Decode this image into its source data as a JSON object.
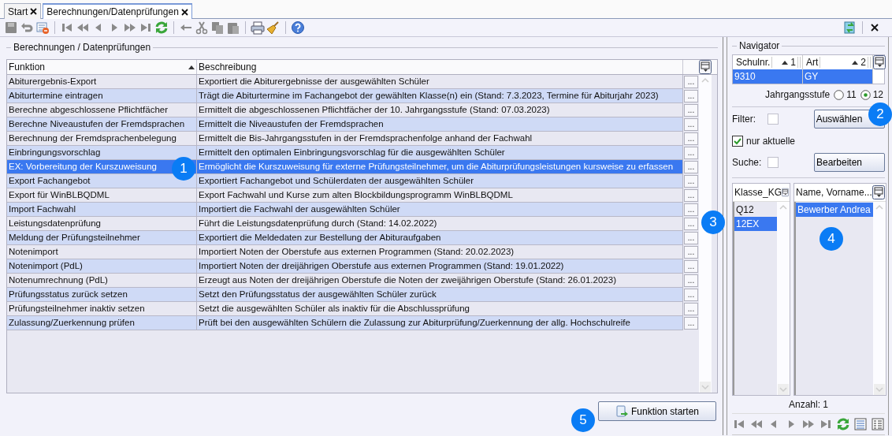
{
  "tabs": [
    {
      "label": "Start",
      "selected": false
    },
    {
      "label": "Berechnungen/Datenprüfungen",
      "selected": true
    }
  ],
  "group_title": "Berechnungen / Datenprüfungen",
  "table": {
    "columns": [
      "Funktion",
      "Beschreibung"
    ],
    "rows": [
      {
        "funktion": "Abiturergebnis-Export",
        "beschreibung": "Exportiert die Abiturergebnisse der ausgewählten Schüler",
        "button": "...",
        "selected": false
      },
      {
        "funktion": "Abiturtermine eintragen",
        "beschreibung": "Trägt die Abiturtermine im Fachangebot der gewählten Klasse(n) ein (Stand: 7.3.2023, Termine für Abiturjahr 2023)",
        "button": "...",
        "selected": false
      },
      {
        "funktion": "Berechne abgeschlossene Pflichtfächer",
        "beschreibung": "Ermittelt die abgeschlossenen Pflichtfächer der 10. Jahrgangsstufe (Stand: 07.03.2023)",
        "button": "...",
        "selected": false
      },
      {
        "funktion": "Berechne Niveaustufen der Fremdsprachen",
        "beschreibung": "Ermittelt die Niveaustufen der Fremdsprachen",
        "button": "...",
        "selected": false
      },
      {
        "funktion": "Berechnung der Fremdsprachenbelegung",
        "beschreibung": "Ermittelt die Bis-Jahrgangsstufen in der Fremdsprachenfolge anhand der Fachwahl",
        "button": "...",
        "selected": false
      },
      {
        "funktion": "Einbringungsvorschlag",
        "beschreibung": "Ermittelt den optimalen Einbringungsvorschlag für die ausgewählten Schüler",
        "button": "...",
        "selected": false
      },
      {
        "funktion": "EX: Vorbereitung der Kurszuweisung",
        "beschreibung": "Ermöglicht die Kurszuweisung für externe Prüfungsteilnehmer, um die Abiturprüfungsleistungen kursweise zu erfassen",
        "button": "...",
        "selected": true
      },
      {
        "funktion": "Export Fachangebot",
        "beschreibung": "Exportiert Fachangebot und Schülerdaten der ausgewählten Schüler",
        "button": "...",
        "selected": false
      },
      {
        "funktion": "Export für WinBLBQDML",
        "beschreibung": "Export Fachwahl und Kurse zum alten Blockbildungsprogramm WinBLBQDML",
        "button": "...",
        "selected": false
      },
      {
        "funktion": "Import Fachwahl",
        "beschreibung": "Importiert die Fachwahl der ausgewählten Schüler",
        "button": "...",
        "selected": false
      },
      {
        "funktion": "Leistungsdatenprüfung",
        "beschreibung": "Führt die Leistungsdatenprüfung durch (Stand: 14.02.2022)",
        "button": "...",
        "selected": false
      },
      {
        "funktion": "Meldung der Prüfungsteilnehmer",
        "beschreibung": "Exportiert die Meldedaten zur Bestellung der Abituraufgaben",
        "button": "...",
        "selected": false
      },
      {
        "funktion": "Notenimport",
        "beschreibung": "Importiert Noten der Oberstufe aus externen Programmen (Stand: 20.02.2023)",
        "button": "...",
        "selected": false
      },
      {
        "funktion": "Notenimport (PdL)",
        "beschreibung": "Importiert Noten der dreijährigen Oberstufe aus externen Programmen (Stand: 19.01.2022)",
        "button": "...",
        "selected": false
      },
      {
        "funktion": "Notenumrechnung (PdL)",
        "beschreibung": "Erzeugt aus Noten der dreijährigen Oberstufe die Noten der zweijährigen Oberstufe (Stand: 26.01.2023)",
        "button": "...",
        "selected": false
      },
      {
        "funktion": "Prüfungsstatus zurück setzen",
        "beschreibung": "Setzt den Prüfungsstatus der ausgewählten Schüler zurück",
        "button": "...",
        "selected": false
      },
      {
        "funktion": "Prüfungsteilnehmer inaktiv setzen",
        "beschreibung": "Setzt die ausgewählten Schüler als inaktiv für die Abschlussprüfung",
        "button": "...",
        "selected": false
      },
      {
        "funktion": "Zulassung/Zuerkennung prüfen",
        "beschreibung": "Prüft bei den ausgewählten Schülern die Zulassung zur Abiturprüfung/Zuerkennung der allg. Hochschulreife",
        "button": "...",
        "selected": false
      }
    ]
  },
  "start_button": "Funktion starten",
  "navigator": {
    "title": "Navigator",
    "school_table": {
      "columns": [
        {
          "label": "Schulnr.",
          "sort": "1"
        },
        {
          "label": "Art",
          "sort": "2"
        }
      ],
      "rows": [
        {
          "cells": [
            "9310",
            "GY"
          ],
          "selected": true
        }
      ]
    },
    "jahrgangsstufe": {
      "label": "Jahrgangsstufe",
      "options": [
        {
          "label": "11",
          "selected": false
        },
        {
          "label": "12",
          "selected": true
        }
      ]
    },
    "filter": {
      "label": "Filter:",
      "checked": false
    },
    "select_button": "Auswählen",
    "nur_aktuelle": {
      "label": "nur aktuelle",
      "checked": true
    },
    "suche": {
      "label": "Suche:",
      "checked": false
    },
    "edit_button": "Bearbeiten",
    "class_list": {
      "header": "Klasse_KG",
      "items": [
        {
          "label": "Q12",
          "selected": false
        },
        {
          "label": "12EX",
          "selected": true
        }
      ]
    },
    "name_list": {
      "header": "Name, Vorname...",
      "items": [
        {
          "label": "Bewerber Andrea",
          "selected": true
        }
      ]
    },
    "count": "Anzahl: 1"
  },
  "callouts": [
    "1",
    "2",
    "3",
    "4",
    "5"
  ]
}
